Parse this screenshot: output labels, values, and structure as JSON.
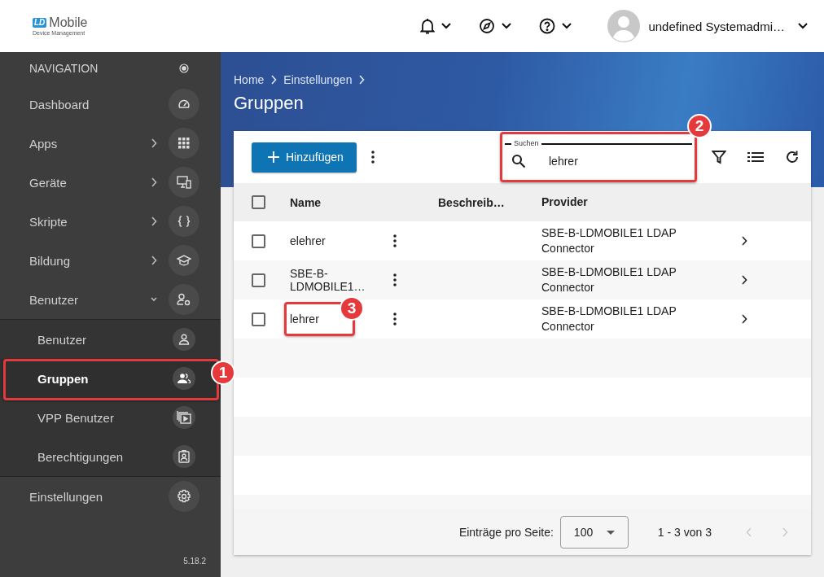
{
  "header": {
    "logo": {
      "badge": "LD",
      "name": "Mobile",
      "tagline": "Device Management"
    },
    "user": {
      "name": "undefined Systemadmi…"
    }
  },
  "navigation": {
    "title": "NAVIGATION",
    "items": [
      {
        "label": "Dashboard"
      },
      {
        "label": "Apps",
        "expanded": false
      },
      {
        "label": "Geräte",
        "expanded": false
      },
      {
        "label": "Skripte",
        "expanded": false
      },
      {
        "label": "Bildung",
        "expanded": false
      },
      {
        "label": "Benutzer",
        "expanded": true,
        "children": [
          {
            "label": "Benutzer",
            "selected": false
          },
          {
            "label": "Gruppen",
            "selected": true,
            "callout": "1"
          },
          {
            "label": "VPP Benutzer",
            "selected": false
          },
          {
            "label": "Berechtigungen",
            "selected": false
          }
        ]
      },
      {
        "label": "Einstellungen"
      }
    ],
    "version": "5.18.2"
  },
  "breadcrumb": [
    "Home",
    "Einstellungen"
  ],
  "page_title": "Gruppen",
  "toolbar": {
    "add_button": "Hinzufügen",
    "search": {
      "label": "Suchen",
      "value": "lehrer",
      "callout": "2"
    }
  },
  "table": {
    "header_checked": false,
    "columns": [
      "Name",
      "Beschreib…",
      "Provider"
    ],
    "rows": [
      {
        "name": "elehrer",
        "provider": "SBE-B-LDMOBILE1 LDAP Connector",
        "checked": false
      },
      {
        "name": "SBE-B-LDMOBILE1…",
        "provider": "SBE-B-LDMOBILE1 LDAP Connector",
        "checked": false
      },
      {
        "name": "lehrer",
        "provider": "SBE-B-LDMOBILE1 LDAP Connector",
        "checked": false,
        "callout": "3"
      }
    ]
  },
  "footer": {
    "per_page_label": "Einträge pro Seite:",
    "per_page": "100",
    "range": "1 - 3 von 3",
    "prev_disabled": true,
    "next_disabled": true
  }
}
